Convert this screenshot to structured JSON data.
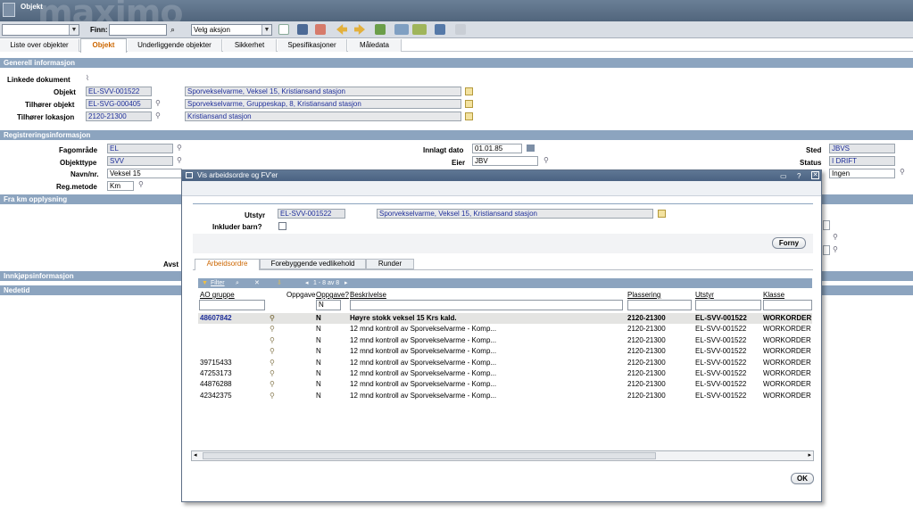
{
  "app": {
    "title": "Objekt",
    "brand": "maximo"
  },
  "toolbar": {
    "finn_label": "Finn:",
    "finn_value": "",
    "action_select": "Velg aksjon",
    "colors": {
      "accent": "#cc6600",
      "section": "#8ca4bf"
    }
  },
  "tabs": [
    "Liste over objekter",
    "Objekt",
    "Underliggende objekter",
    "Sikkerhet",
    "Spesifikasjoner",
    "Måledata"
  ],
  "sections": {
    "general": "Generell informasjon",
    "registration": "Registreringsinformasjon",
    "fra_km": "Fra km opplysning",
    "innkjop": "Innkjøpsinformasjon",
    "nedetid": "Nedetid"
  },
  "general": {
    "linked_docs_label": "Linkede dokument",
    "objekt_label": "Objekt",
    "objekt_value": "EL-SVV-001522",
    "objekt_desc": "Sporvekselvarme, Veksel 15, Kristiansand stasjon",
    "tilhorer_label": "Tilhører objekt",
    "tilhorer_value": "EL-SVG-000405",
    "tilhorer_desc": "Sporvekselvarme, Gruppeskap, 8, Kristiansand stasjon",
    "lokasjon_label": "Tilhører lokasjon",
    "lokasjon_value": "2120-21300",
    "lokasjon_desc": "Kristiansand stasjon"
  },
  "registration": {
    "fagomrade_label": "Fagområde",
    "fagomrade_value": "EL",
    "objekttype_label": "Objekttype",
    "objekttype_value": "SVV",
    "navn_label": "Navn/nr.",
    "navn_value": "Veksel 15",
    "regmetode_label": "Reg.metode",
    "regmetode_value": "Km",
    "innlagt_label": "Innlagt dato",
    "innlagt_value": "01.01.85",
    "eier_label": "Eier",
    "eier_value": "JBV",
    "sted_label": "Sted",
    "sted_value": "JBVS",
    "status_label": "Status",
    "status_value": "I DRIFT",
    "ingen_value": "Ingen",
    "avst_label": "Avst"
  },
  "dialog": {
    "title": "Vis arbeidsordre og FV'er",
    "utstyr_label": "Utstyr",
    "utstyr_value": "EL-SVV-001522",
    "utstyr_desc": "Sporvekselvarme, Veksel 15, Kristiansand stasjon",
    "inkluder_label": "Inkluder barn?",
    "refresh_button": "Forny",
    "ok_button": "OK",
    "tabs": [
      "Arbeidsordre",
      "Forebyggende vedlikehold",
      "Runder"
    ],
    "filter_label": "Filter",
    "paging": "1 - 8 av 8",
    "columns": {
      "ao": "AO gruppe",
      "oppgave": "Oppgave",
      "oppgave2": "Oppgave?",
      "beskrivelse": "Beskrivelse",
      "plassering": "Plassering",
      "utstyr": "Utstyr",
      "klasse": "Klasse"
    },
    "filter_oppgave2": "N",
    "rows": [
      {
        "ao": "48607842",
        "opp": "N",
        "desc": "Høyre stokk veksel 15 Krs kald.",
        "plass": "2120-21300",
        "utstyr": "EL-SVV-001522",
        "klasse": "WORKORDER"
      },
      {
        "ao": "",
        "opp": "N",
        "desc": "12 mnd kontroll av Sporvekselvarme - Komp...",
        "plass": "2120-21300",
        "utstyr": "EL-SVV-001522",
        "klasse": "WORKORDER"
      },
      {
        "ao": "",
        "opp": "N",
        "desc": "12 mnd kontroll av Sporvekselvarme - Komp...",
        "plass": "2120-21300",
        "utstyr": "EL-SVV-001522",
        "klasse": "WORKORDER"
      },
      {
        "ao": "",
        "opp": "N",
        "desc": "12 mnd kontroll av Sporvekselvarme - Komp...",
        "plass": "2120-21300",
        "utstyr": "EL-SVV-001522",
        "klasse": "WORKORDER"
      },
      {
        "ao": "39715433",
        "opp": "N",
        "desc": "12 mnd kontroll av Sporvekselvarme - Komp...",
        "plass": "2120-21300",
        "utstyr": "EL-SVV-001522",
        "klasse": "WORKORDER"
      },
      {
        "ao": "47253173",
        "opp": "N",
        "desc": "12 mnd kontroll av Sporvekselvarme - Komp...",
        "plass": "2120-21300",
        "utstyr": "EL-SVV-001522",
        "klasse": "WORKORDER"
      },
      {
        "ao": "44876288",
        "opp": "N",
        "desc": "12 mnd kontroll av Sporvekselvarme - Komp...",
        "plass": "2120-21300",
        "utstyr": "EL-SVV-001522",
        "klasse": "WORKORDER"
      },
      {
        "ao": "42342375",
        "opp": "N",
        "desc": "12 mnd kontroll av Sporvekselvarme - Komp...",
        "plass": "2120-21300",
        "utstyr": "EL-SVV-001522",
        "klasse": "WORKORDER"
      }
    ]
  }
}
